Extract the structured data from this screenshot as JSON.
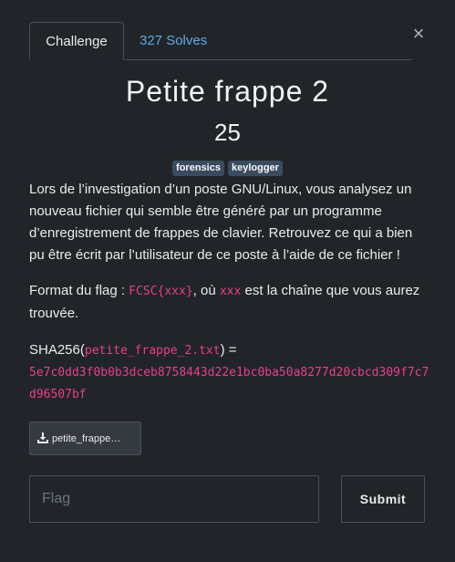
{
  "tabs": {
    "challenge": "Challenge",
    "solves": "327 Solves"
  },
  "close_icon": "×",
  "challenge": {
    "name": "Petite frappe 2",
    "value": "25",
    "tags": [
      "forensics",
      "keylogger"
    ],
    "description_p1": "Lors de l’investigation d’un poste GNU/Linux, vous analysez un nouveau fichier qui semble être généré par un programme d’enregistrement de frappes de clavier. Retrouvez ce qui a bien pu être écrit par l’utilisateur de ce poste à l’aide de ce fichier !",
    "format_prefix": "Format du flag : ",
    "format_code": "FCSC{xxx}",
    "format_mid": ", où ",
    "format_var": "xxx",
    "format_suffix": " est la chaîne que vous aurez trouvée.",
    "sha_prefix": "SHA256(",
    "sha_file": "petite_frappe_2.txt",
    "sha_suffix": ") =",
    "sha_hash": "5e7c0dd3f0b0b3dceb8758443d22e1bc0ba50a8277d20cbcd309f7c7d96507bf"
  },
  "file": {
    "icon": "download-icon",
    "label": "petite_frappe…"
  },
  "form": {
    "flag_placeholder": "Flag",
    "flag_value": "",
    "submit_label": "Submit"
  },
  "colors": {
    "background": "#212529",
    "accent_link": "#5ea8e8",
    "code": "#e83e8c",
    "tag_bg": "#3b4b5f"
  }
}
